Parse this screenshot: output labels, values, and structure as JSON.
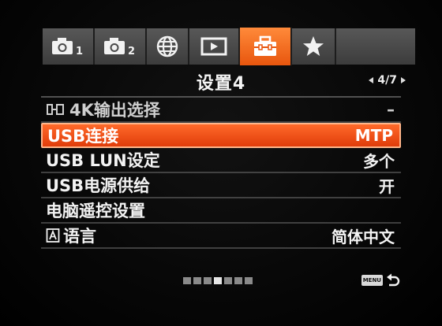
{
  "tabs": [
    {
      "id": "camera1",
      "icon": "camera-icon",
      "number": "1",
      "active": false
    },
    {
      "id": "camera2",
      "icon": "camera-icon",
      "number": "2",
      "active": false
    },
    {
      "id": "network",
      "icon": "globe-icon",
      "active": false
    },
    {
      "id": "playback",
      "icon": "play-icon",
      "active": false
    },
    {
      "id": "setup",
      "icon": "toolbox-icon",
      "active": true
    },
    {
      "id": "mymenu",
      "icon": "star-icon",
      "active": false
    }
  ],
  "header": {
    "title": "设置4",
    "page": "4/7"
  },
  "menu": {
    "items": [
      {
        "label": "4K输出选择",
        "value": "–",
        "icon": "hdmi-output-icon",
        "selected": false,
        "dim": true
      },
      {
        "label": "USB连接",
        "value": "MTP",
        "selected": true
      },
      {
        "label": "USB LUN设定",
        "value": "多个",
        "selected": false
      },
      {
        "label": "USB电源供给",
        "value": "开",
        "selected": false
      },
      {
        "label": "电脑遥控设置",
        "value": "",
        "selected": false
      },
      {
        "label": "语言",
        "value": "简体中文",
        "icon": "language-icon",
        "selected": false
      }
    ]
  },
  "footer": {
    "page_indicator_count": 7,
    "page_indicator_current": 4,
    "menu_badge": "MENU",
    "back_icon": "return-arrow-icon"
  },
  "colors": {
    "accent": "#ef5214",
    "accent_border": "#ffb58a",
    "tab_bg": "#4a4a4a",
    "text": "#f2f2f2"
  }
}
